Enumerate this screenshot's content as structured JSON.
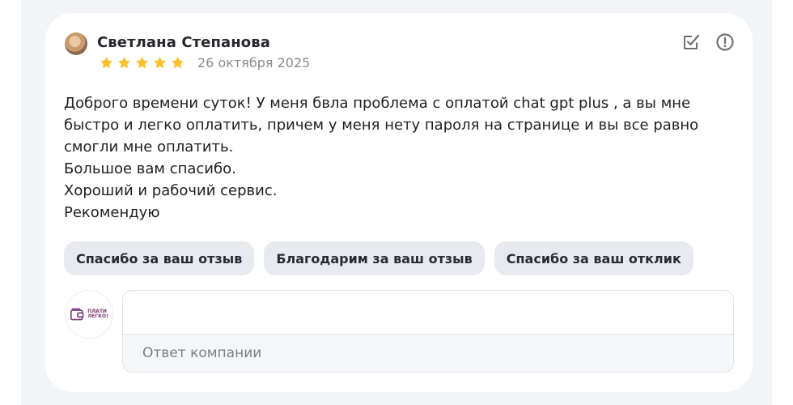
{
  "review": {
    "author": "Светлана Степанова",
    "rating": 5,
    "date": "26 октября 2025",
    "text": "Доброго времени суток! У меня бвла проблема с оплатой chat gpt plus , а вы мне\nбыстро и легко оплатить, причем у меня нету пароля на странице и вы все равно\nсмогли мне оплатить.\nБольшое вам спасибо.\nХороший и рабочий сервис.\nРекомендую"
  },
  "icons": {
    "avatar": "user-photo",
    "star": "star-icon",
    "mark": "checkbox-edit-icon",
    "report": "alert-circle-icon"
  },
  "colors": {
    "star": "#fbc02d",
    "logo": "#7a3b79"
  },
  "quick_replies": [
    "Спасибо за ваш отзыв",
    "Благодарим за ваш отзыв",
    "Спасибо за ваш отклик"
  ],
  "company": {
    "logo_text": [
      "ПЛАТИ",
      "ЛЕГКО!"
    ]
  },
  "reply": {
    "placeholder": "Ответ компании"
  }
}
